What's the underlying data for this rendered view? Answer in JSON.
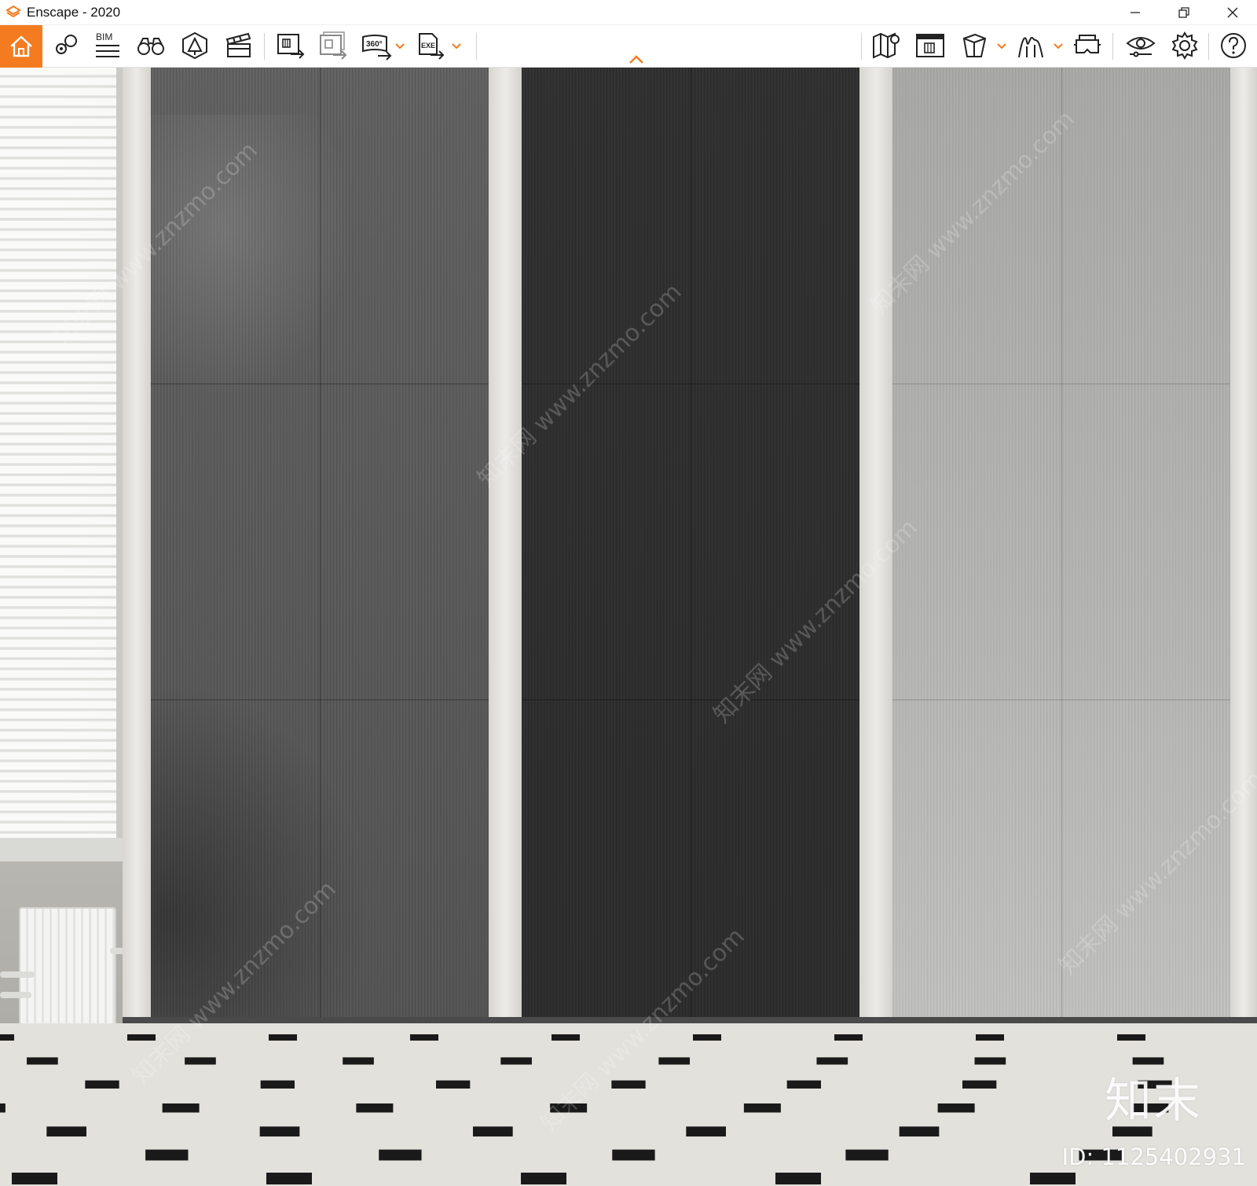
{
  "window": {
    "title": "Enscape - 2020",
    "brand_color": "#f47b20"
  },
  "toolbar": {
    "bim_label": "BIM",
    "panorama_label": "360°",
    "exe_label": "EXE",
    "icons": [
      "home-icon",
      "visual-settings-icon",
      "bim-list-icon",
      "binoculars-icon",
      "asset-library-icon",
      "video-editor-icon",
      "screenshot-render-icon",
      "batch-render-icon",
      "panorama-360-icon",
      "export-exe-icon",
      "map-icon",
      "render-window-icon",
      "cube-icon",
      "material-editor-icon",
      "vr-headset-icon",
      "visibility-eye-icon",
      "settings-gear-icon",
      "help-icon"
    ]
  },
  "scene": {
    "panel_colors": [
      "#5d5d5d",
      "#2e2e2e",
      "#b5b5b3"
    ],
    "watermark_text": "知末网 www.znzmo.com",
    "brand_text": "知末",
    "image_id": "ID: 1125402931"
  }
}
